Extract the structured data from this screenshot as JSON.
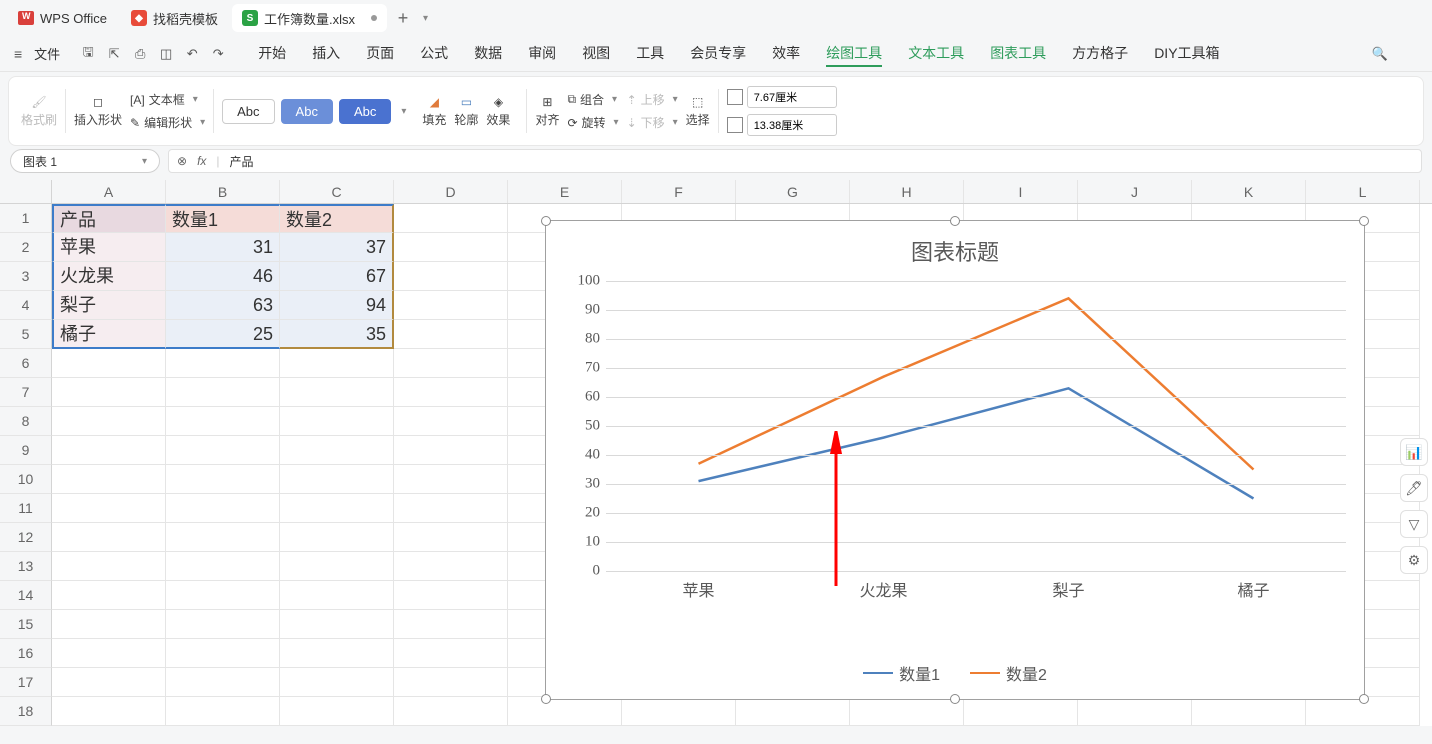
{
  "titlebar": {
    "app_name": "WPS Office",
    "tabs": [
      {
        "icon": "red",
        "label": "找稻壳模板"
      },
      {
        "icon": "green",
        "icon_letter": "S",
        "label": "工作簿数量.xlsx",
        "modified": true
      }
    ]
  },
  "menubar": {
    "file_label": "文件",
    "tabs": [
      "开始",
      "插入",
      "页面",
      "公式",
      "数据",
      "审阅",
      "视图",
      "工具",
      "会员专享",
      "效率",
      "绘图工具",
      "文本工具",
      "图表工具",
      "方方格子",
      "DIY工具箱"
    ],
    "active_tab_index": 10,
    "highlight_indices": [
      10,
      11,
      12
    ]
  },
  "toolbar": {
    "format_painter": "格式刷",
    "insert_shape": "插入形状",
    "text_box": "文本框",
    "edit_shape": "编辑形状",
    "abc_labels": [
      "Abc",
      "Abc",
      "Abc"
    ],
    "fill": "填充",
    "outline": "轮廓",
    "effect": "效果",
    "align": "对齐",
    "group": "组合",
    "rotate": "旋转",
    "move_up": "上移",
    "move_down": "下移",
    "select": "选择",
    "height_value": "7.67厘米",
    "width_value": "13.38厘米"
  },
  "formula_bar": {
    "name_box": "图表 1",
    "fx": "fx",
    "formula_value": "产品"
  },
  "sheet": {
    "columns": [
      "A",
      "B",
      "C",
      "D",
      "E",
      "F",
      "G",
      "H",
      "I",
      "J",
      "K",
      "L"
    ],
    "row_numbers": [
      1,
      2,
      3,
      4,
      5,
      6,
      7,
      8,
      9,
      10,
      11,
      12,
      13,
      14,
      15,
      16,
      17,
      18
    ],
    "headers": [
      "产品",
      "数量1",
      "数量2"
    ],
    "rows": [
      {
        "product": "苹果",
        "q1": 31,
        "q2": 37
      },
      {
        "product": "火龙果",
        "q1": 46,
        "q2": 67
      },
      {
        "product": "梨子",
        "q1": 63,
        "q2": 94
      },
      {
        "product": "橘子",
        "q1": 25,
        "q2": 35
      }
    ]
  },
  "chart_data": {
    "type": "line",
    "title": "图表标题",
    "categories": [
      "苹果",
      "火龙果",
      "梨子",
      "橘子"
    ],
    "series": [
      {
        "name": "数量1",
        "values": [
          31,
          46,
          63,
          25
        ],
        "color": "#4e81bd"
      },
      {
        "name": "数量2",
        "values": [
          37,
          67,
          94,
          35
        ],
        "color": "#ed7d31"
      }
    ],
    "ylim": [
      0,
      100
    ],
    "yticks": [
      0,
      10,
      20,
      30,
      40,
      50,
      60,
      70,
      80,
      90,
      100
    ],
    "xlabel": "",
    "ylabel": ""
  }
}
